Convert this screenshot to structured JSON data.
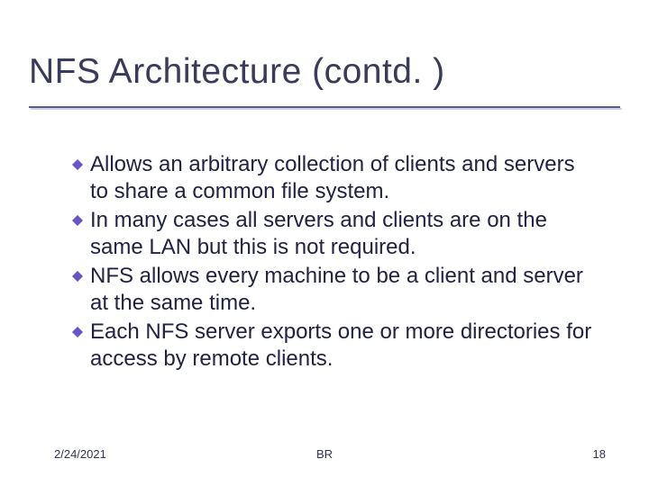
{
  "title": "NFS Architecture (contd. )",
  "bullets": [
    "Allows an arbitrary collection of clients and servers to share a common file system.",
    "In many cases all servers and clients are on the same LAN but this is not required.",
    "NFS allows every machine to be a client and server at the same time.",
    "Each NFS server exports one or more directories for access by remote clients."
  ],
  "footer": {
    "date": "2/24/2021",
    "author": "BR",
    "page": "18"
  },
  "colors": {
    "bullet_fill": "#6a53c7",
    "bullet_shadow": "#c8c0e8"
  }
}
